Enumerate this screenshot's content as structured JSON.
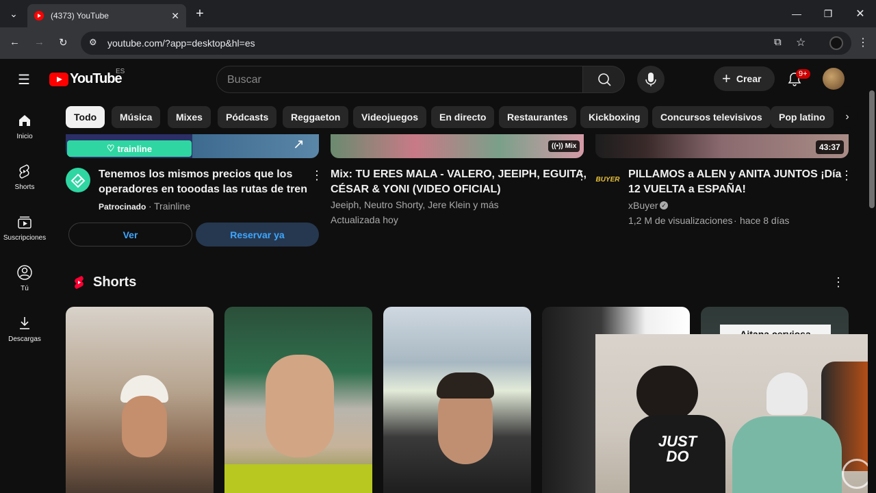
{
  "browser": {
    "tab_title": "(4373) YouTube",
    "url": "youtube.com/?app=desktop&hl=es"
  },
  "header": {
    "logo_text": "YouTube",
    "region": "ES",
    "search_placeholder": "Buscar",
    "create_label": "Crear",
    "notifications_badge": "9+"
  },
  "sidebar": {
    "items": [
      {
        "label": "Inicio",
        "icon": "home-icon"
      },
      {
        "label": "Shorts",
        "icon": "shorts-icon"
      },
      {
        "label": "Suscripciones",
        "icon": "subscriptions-icon"
      },
      {
        "label": "Tú",
        "icon": "user-icon"
      },
      {
        "label": "Descargas",
        "icon": "download-icon"
      }
    ]
  },
  "chips": [
    "Todo",
    "Música",
    "Mixes",
    "Pódcasts",
    "Reggaeton",
    "Videojuegos",
    "En directo",
    "Restaurantes",
    "Kickboxing",
    "Concursos televisivos",
    "Pop latino"
  ],
  "videos": {
    "ad": {
      "brand_label": "trainline",
      "title_line1": "Tenemos los mismos precios que los",
      "title_line2": "operadores en tooodas las rutas de tren",
      "sponsored": "Patrocinado",
      "channel": "Trainline",
      "btn_ver": "Ver",
      "btn_reservar": "Reservar ya"
    },
    "mix": {
      "badge": "Mix",
      "title_line1": "Mix: TU ERES MALA - VALERO, JEEIPH, EGUITA,",
      "title_line2": "CÉSAR & YONI (VIDEO OFICIAL)",
      "channels": "Jeeiph, Neutro Shorty, Jere Klein y más",
      "updated": "Actualizada hoy"
    },
    "third": {
      "duration": "43:37",
      "channel_logo_text": "BUYER",
      "title_line1": "PILLAMOS a ALEN y ANITA JUNTOS ¡Día",
      "title_line2": "12 VUELTA a ESPAÑA!",
      "channel": "xBuyer",
      "views": "1,2 M de visualizaciones",
      "age": "hace 8 días"
    }
  },
  "shorts": {
    "section_title": "Shorts",
    "fifth_overlay_text": "Aitana cerviosa"
  },
  "pip": {
    "shirt_text_line1": "JUST",
    "shirt_text_line2": "DO"
  }
}
